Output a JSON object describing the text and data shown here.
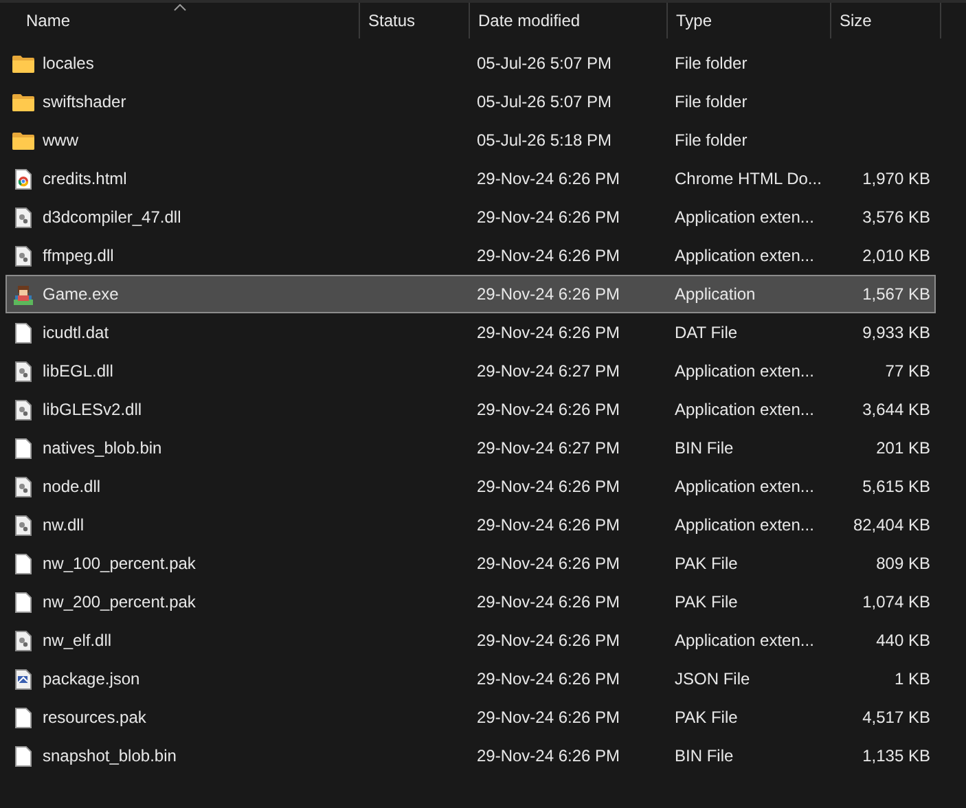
{
  "columns": [
    {
      "label": "Name",
      "sorted": true
    },
    {
      "label": "Status",
      "sorted": false
    },
    {
      "label": "Date modified",
      "sorted": false
    },
    {
      "label": "Type",
      "sorted": false
    },
    {
      "label": "Size",
      "sorted": false
    }
  ],
  "rows": [
    {
      "kind": "folder",
      "name": "locales",
      "date": "05-Jul-26 5:07 PM",
      "type": "File folder",
      "size": "",
      "selected": false
    },
    {
      "kind": "folder",
      "name": "swiftshader",
      "date": "05-Jul-26 5:07 PM",
      "type": "File folder",
      "size": "",
      "selected": false
    },
    {
      "kind": "folder",
      "name": "www",
      "date": "05-Jul-26 5:18 PM",
      "type": "File folder",
      "size": "",
      "selected": false
    },
    {
      "kind": "html",
      "name": "credits.html",
      "date": "29-Nov-24 6:26 PM",
      "type": "Chrome HTML Do...",
      "size": "1,970 KB",
      "selected": false
    },
    {
      "kind": "dll",
      "name": "d3dcompiler_47.dll",
      "date": "29-Nov-24 6:26 PM",
      "type": "Application exten...",
      "size": "3,576 KB",
      "selected": false
    },
    {
      "kind": "dll",
      "name": "ffmpeg.dll",
      "date": "29-Nov-24 6:26 PM",
      "type": "Application exten...",
      "size": "2,010 KB",
      "selected": false
    },
    {
      "kind": "app",
      "name": "Game.exe",
      "date": "29-Nov-24 6:26 PM",
      "type": "Application",
      "size": "1,567 KB",
      "selected": true
    },
    {
      "kind": "file",
      "name": "icudtl.dat",
      "date": "29-Nov-24 6:26 PM",
      "type": "DAT File",
      "size": "9,933 KB",
      "selected": false
    },
    {
      "kind": "dll",
      "name": "libEGL.dll",
      "date": "29-Nov-24 6:27 PM",
      "type": "Application exten...",
      "size": "77 KB",
      "selected": false
    },
    {
      "kind": "dll",
      "name": "libGLESv2.dll",
      "date": "29-Nov-24 6:26 PM",
      "type": "Application exten...",
      "size": "3,644 KB",
      "selected": false
    },
    {
      "kind": "file",
      "name": "natives_blob.bin",
      "date": "29-Nov-24 6:27 PM",
      "type": "BIN File",
      "size": "201 KB",
      "selected": false
    },
    {
      "kind": "dll",
      "name": "node.dll",
      "date": "29-Nov-24 6:26 PM",
      "type": "Application exten...",
      "size": "5,615 KB",
      "selected": false
    },
    {
      "kind": "dll",
      "name": "nw.dll",
      "date": "29-Nov-24 6:26 PM",
      "type": "Application exten...",
      "size": "82,404 KB",
      "selected": false
    },
    {
      "kind": "file",
      "name": "nw_100_percent.pak",
      "date": "29-Nov-24 6:26 PM",
      "type": "PAK File",
      "size": "809 KB",
      "selected": false
    },
    {
      "kind": "file",
      "name": "nw_200_percent.pak",
      "date": "29-Nov-24 6:26 PM",
      "type": "PAK File",
      "size": "1,074 KB",
      "selected": false
    },
    {
      "kind": "dll",
      "name": "nw_elf.dll",
      "date": "29-Nov-24 6:26 PM",
      "type": "Application exten...",
      "size": "440 KB",
      "selected": false
    },
    {
      "kind": "json",
      "name": "package.json",
      "date": "29-Nov-24 6:26 PM",
      "type": "JSON File",
      "size": "1 KB",
      "selected": false
    },
    {
      "kind": "file",
      "name": "resources.pak",
      "date": "29-Nov-24 6:26 PM",
      "type": "PAK File",
      "size": "4,517 KB",
      "selected": false
    },
    {
      "kind": "file",
      "name": "snapshot_blob.bin",
      "date": "29-Nov-24 6:26 PM",
      "type": "BIN File",
      "size": "1,135 KB",
      "selected": false
    }
  ]
}
